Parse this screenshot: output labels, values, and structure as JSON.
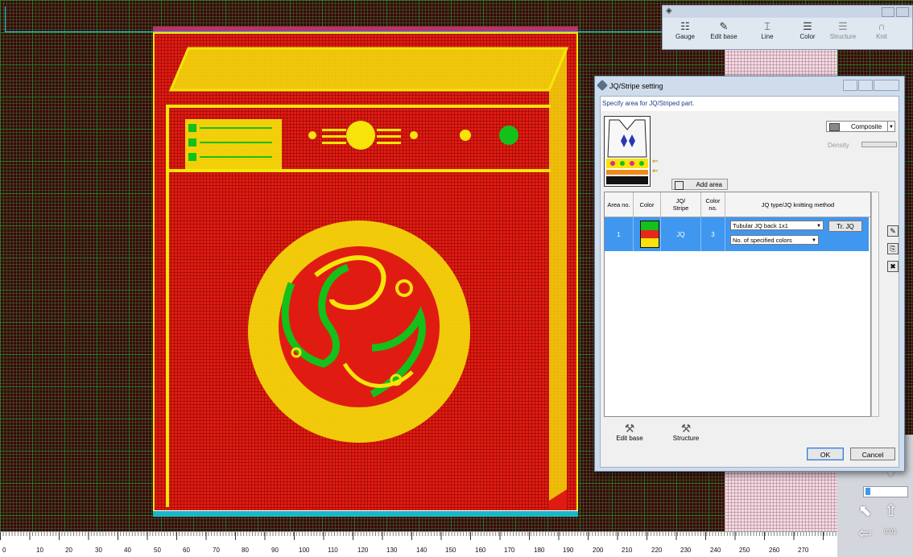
{
  "toolbar": {
    "items": [
      {
        "label": "Gauge",
        "icon": "gauge-icon"
      },
      {
        "label": "Edit base",
        "icon": "edit-base-icon"
      },
      {
        "label": "Line",
        "icon": "line-icon"
      },
      {
        "label": "Color",
        "icon": "color-icon"
      },
      {
        "label": "Structure",
        "icon": "structure-icon"
      },
      {
        "label": "Knit",
        "icon": "knit-icon"
      }
    ]
  },
  "ruler": {
    "ticks": [
      "0",
      "10",
      "20",
      "30",
      "40",
      "50",
      "60",
      "70",
      "80",
      "90",
      "100",
      "110",
      "120",
      "130",
      "140",
      "150",
      "160",
      "170",
      "180",
      "190",
      "200",
      "210",
      "220",
      "230",
      "240",
      "250",
      "260",
      "270"
    ]
  },
  "zoom_readout": "0.01",
  "dialog": {
    "title": "JQ/Stripe setting",
    "hint": "Specify area for JQ/Striped part.",
    "add_area_label": "Add area",
    "composite_label": "Composite",
    "density_label": "Density",
    "columns": [
      "Area no.",
      "Color",
      "JQ/\nStripe",
      "Color\nno.",
      "JQ type/JQ knitting method"
    ],
    "rows": [
      {
        "area_no": "1",
        "colors": [
          "#14c01a",
          "#e8281a",
          "#f6e40a"
        ],
        "jq_stripe": "JQ",
        "color_no": "3",
        "jq_type": "Tubular JQ back 1x1",
        "method": "No. of specified colors",
        "button": "Tr. JQ"
      }
    ],
    "edit_base_label": "Edit base",
    "structure_label": "Structure",
    "ok_label": "OK",
    "cancel_label": "Cancel"
  },
  "colors": {
    "background_red": "#e01c12",
    "yellow": "#f6e40a",
    "green": "#14c01a",
    "selection_blue": "#3f97ef"
  }
}
